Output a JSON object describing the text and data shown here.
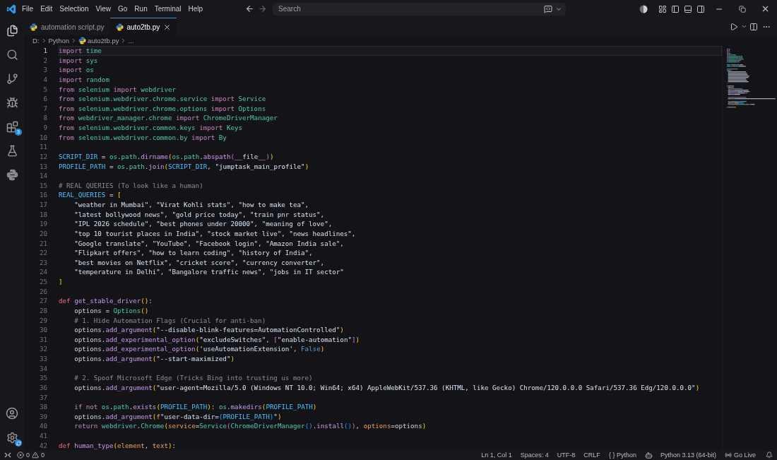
{
  "menu": [
    "File",
    "Edit",
    "Selection",
    "View",
    "Go",
    "Run",
    "Terminal",
    "Help"
  ],
  "search": {
    "placeholder": "Search"
  },
  "activity": {
    "extensions_badge": "3"
  },
  "tabs": [
    {
      "label": "automation script.py",
      "selected": false
    },
    {
      "label": "auto2tb.py",
      "selected": true
    }
  ],
  "breadcrumb": [
    {
      "kind": "folder",
      "label": "D:"
    },
    {
      "kind": "folder",
      "label": "Python"
    },
    {
      "kind": "file",
      "label": "auto2tb.py"
    },
    {
      "kind": "more",
      "label": "..."
    }
  ],
  "editor": {
    "lines": [
      {
        "number": "1",
        "current": true,
        "tokens": [
          {
            "kind": "kw",
            "text": "import "
          },
          {
            "kind": "mod",
            "text": "time"
          }
        ]
      },
      {
        "number": "2",
        "current": false,
        "tokens": [
          {
            "kind": "kw",
            "text": "import "
          },
          {
            "kind": "mod",
            "text": "sys"
          }
        ]
      },
      {
        "number": "3",
        "current": false,
        "tokens": [
          {
            "kind": "kw",
            "text": "import "
          },
          {
            "kind": "mod",
            "text": "os"
          }
        ]
      },
      {
        "number": "4",
        "current": false,
        "tokens": [
          {
            "kind": "kw",
            "text": "import "
          },
          {
            "kind": "mod",
            "text": "random"
          }
        ]
      },
      {
        "number": "5",
        "current": false,
        "tokens": [
          {
            "kind": "kw",
            "text": "from "
          },
          {
            "kind": "mod",
            "text": "selenium "
          },
          {
            "kind": "kw",
            "text": "import "
          },
          {
            "kind": "mod",
            "text": "webdriver"
          }
        ]
      },
      {
        "number": "6",
        "current": false,
        "tokens": [
          {
            "kind": "kw",
            "text": "from "
          },
          {
            "kind": "mod",
            "text": "selenium.webdriver.chrome.service "
          },
          {
            "kind": "kw",
            "text": "import "
          },
          {
            "kind": "cls",
            "text": "Service"
          }
        ]
      },
      {
        "number": "7",
        "current": false,
        "tokens": [
          {
            "kind": "kw",
            "text": "from "
          },
          {
            "kind": "mod",
            "text": "selenium.webdriver.chrome.options "
          },
          {
            "kind": "kw",
            "text": "import "
          },
          {
            "kind": "cls",
            "text": "Options"
          }
        ]
      },
      {
        "number": "8",
        "current": false,
        "tokens": [
          {
            "kind": "kw",
            "text": "from "
          },
          {
            "kind": "mod",
            "text": "webdriver_manager.chrome "
          },
          {
            "kind": "kw",
            "text": "import "
          },
          {
            "kind": "cls",
            "text": "ChromeDriverManager"
          }
        ]
      },
      {
        "number": "9",
        "current": false,
        "tokens": [
          {
            "kind": "kw",
            "text": "from "
          },
          {
            "kind": "mod",
            "text": "selenium.webdriver.common.keys "
          },
          {
            "kind": "kw",
            "text": "import "
          },
          {
            "kind": "cls",
            "text": "Keys"
          }
        ]
      },
      {
        "number": "10",
        "current": false,
        "tokens": [
          {
            "kind": "kw",
            "text": "from "
          },
          {
            "kind": "mod",
            "text": "selenium.webdriver.common.by "
          },
          {
            "kind": "kw",
            "text": "import "
          },
          {
            "kind": "cls",
            "text": "By"
          }
        ]
      },
      {
        "number": "11",
        "current": false
      },
      {
        "number": "12",
        "current": false,
        "tokens": [
          {
            "kind": "const",
            "text": "SCRIPT_DIR"
          },
          {
            "kind": "plain",
            "text": " = "
          },
          {
            "kind": "mod",
            "text": "os"
          },
          {
            "kind": "plain",
            "text": "."
          },
          {
            "kind": "mod",
            "text": "path"
          },
          {
            "kind": "plain",
            "text": "."
          },
          {
            "kind": "fn",
            "text": "dirname"
          },
          {
            "kind": "b1",
            "text": "("
          },
          {
            "kind": "mod",
            "text": "os"
          },
          {
            "kind": "plain",
            "text": "."
          },
          {
            "kind": "mod",
            "text": "path"
          },
          {
            "kind": "plain",
            "text": "."
          },
          {
            "kind": "fn",
            "text": "abspath"
          },
          {
            "kind": "b2",
            "text": "("
          },
          {
            "kind": "var",
            "text": "__file__"
          },
          {
            "kind": "b2",
            "text": ")"
          },
          {
            "kind": "b1",
            "text": ")"
          }
        ]
      },
      {
        "number": "13",
        "current": false,
        "tokens": [
          {
            "kind": "const",
            "text": "PROFILE_PATH"
          },
          {
            "kind": "plain",
            "text": " = "
          },
          {
            "kind": "mod",
            "text": "os"
          },
          {
            "kind": "plain",
            "text": "."
          },
          {
            "kind": "mod",
            "text": "path"
          },
          {
            "kind": "plain",
            "text": "."
          },
          {
            "kind": "fn",
            "text": "join"
          },
          {
            "kind": "b1",
            "text": "("
          },
          {
            "kind": "const",
            "text": "SCRIPT_DIR"
          },
          {
            "kind": "plain",
            "text": ", "
          },
          {
            "kind": "str",
            "text": "\"jumptask_main_profile\""
          },
          {
            "kind": "b1",
            "text": ")"
          }
        ]
      },
      {
        "number": "14",
        "current": false
      },
      {
        "number": "15",
        "current": false,
        "tokens": [
          {
            "kind": "com",
            "text": "# REAL QUERIES (To look like a human)"
          }
        ]
      },
      {
        "number": "16",
        "current": false,
        "tokens": [
          {
            "kind": "const",
            "text": "REAL_QUERIES"
          },
          {
            "kind": "plain",
            "text": " = "
          },
          {
            "kind": "b1",
            "text": "["
          }
        ]
      },
      {
        "number": "17",
        "current": false,
        "tokens": [
          {
            "kind": "str",
            "text": "    \"weather in Mumbai\", \"Virat Kohli stats\", \"how to make tea\","
          }
        ]
      },
      {
        "number": "18",
        "current": false,
        "tokens": [
          {
            "kind": "str",
            "text": "    \"latest bollywood news\", \"gold price today\", \"train pnr status\","
          }
        ]
      },
      {
        "number": "19",
        "current": false,
        "tokens": [
          {
            "kind": "str",
            "text": "    \"IPL 2026 schedule\", \"best phones under 20000\", \"meaning of love\","
          }
        ]
      },
      {
        "number": "20",
        "current": false,
        "tokens": [
          {
            "kind": "str",
            "text": "    \"top 10 tourist places in India\", \"stock market live\", \"news headlines\","
          }
        ]
      },
      {
        "number": "21",
        "current": false,
        "tokens": [
          {
            "kind": "str",
            "text": "    \"Google translate\", \"YouTube\", \"Facebook login\", \"Amazon India sale\","
          }
        ]
      },
      {
        "number": "22",
        "current": false,
        "tokens": [
          {
            "kind": "str",
            "text": "    \"Flipkart offers\", \"how to learn coding\", \"history of India\","
          }
        ]
      },
      {
        "number": "23",
        "current": false,
        "tokens": [
          {
            "kind": "str",
            "text": "    \"best movies on Netflix\", \"cricket score\", \"currency converter\","
          }
        ]
      },
      {
        "number": "24",
        "current": false,
        "tokens": [
          {
            "kind": "str",
            "text": "    \"temperature in Delhi\", \"Bangalore traffic news\", \"jobs in IT sector\""
          }
        ]
      },
      {
        "number": "25",
        "current": false,
        "tokens": [
          {
            "kind": "b1",
            "text": "]"
          }
        ]
      },
      {
        "number": "26",
        "current": false
      },
      {
        "number": "27",
        "current": false,
        "tokens": [
          {
            "kind": "def",
            "text": "def "
          },
          {
            "kind": "fn",
            "text": "get_stable_driver"
          },
          {
            "kind": "b1",
            "text": "()"
          },
          {
            "kind": "plain",
            "text": ":"
          }
        ]
      },
      {
        "number": "28",
        "current": false,
        "tokens": [
          {
            "kind": "plain",
            "text": "    options = "
          },
          {
            "kind": "cls",
            "text": "Options"
          },
          {
            "kind": "b1",
            "text": "()"
          }
        ]
      },
      {
        "number": "29",
        "current": false,
        "tokens": [
          {
            "kind": "com",
            "text": "    # 1. Hide Automation Flags (Crucial for anti-ban)"
          }
        ]
      },
      {
        "number": "30",
        "current": false,
        "tokens": [
          {
            "kind": "plain",
            "text": "    options."
          },
          {
            "kind": "fn",
            "text": "add_argument"
          },
          {
            "kind": "b1",
            "text": "("
          },
          {
            "kind": "str",
            "text": "\"--disable-blink-features=AutomationControlled\""
          },
          {
            "kind": "b1",
            "text": ")"
          }
        ]
      },
      {
        "number": "31",
        "current": false,
        "tokens": [
          {
            "kind": "plain",
            "text": "    options."
          },
          {
            "kind": "fn",
            "text": "add_experimental_option"
          },
          {
            "kind": "b1",
            "text": "("
          },
          {
            "kind": "str",
            "text": "\"excludeSwitches\""
          },
          {
            "kind": "plain",
            "text": ", "
          },
          {
            "kind": "b2",
            "text": "["
          },
          {
            "kind": "str",
            "text": "\"enable-automation\""
          },
          {
            "kind": "b2",
            "text": "]"
          },
          {
            "kind": "b1",
            "text": ")"
          }
        ]
      },
      {
        "number": "32",
        "current": false,
        "tokens": [
          {
            "kind": "plain",
            "text": "    options."
          },
          {
            "kind": "fn",
            "text": "add_experimental_option"
          },
          {
            "kind": "b1",
            "text": "("
          },
          {
            "kind": "str",
            "text": "'useAutomationExtension'"
          },
          {
            "kind": "plain",
            "text": ", "
          },
          {
            "kind": "bool",
            "text": "False"
          },
          {
            "kind": "b1",
            "text": ")"
          }
        ]
      },
      {
        "number": "33",
        "current": false,
        "tokens": [
          {
            "kind": "plain",
            "text": "    options."
          },
          {
            "kind": "fn",
            "text": "add_argument"
          },
          {
            "kind": "b1",
            "text": "("
          },
          {
            "kind": "str",
            "text": "\"--start-maximized\""
          },
          {
            "kind": "b1",
            "text": ")"
          }
        ]
      },
      {
        "number": "34",
        "current": false
      },
      {
        "number": "35",
        "current": false,
        "tokens": [
          {
            "kind": "com",
            "text": "    # 2. Spoof Microsoft Edge (Tricks Bing into trusting us more)"
          }
        ]
      },
      {
        "number": "36",
        "current": false,
        "tokens": [
          {
            "kind": "plain",
            "text": "    options."
          },
          {
            "kind": "fn",
            "text": "add_argument"
          },
          {
            "kind": "b1",
            "text": "("
          },
          {
            "kind": "str",
            "text": "\"user-agent=Mozilla/5.0 (Windows NT 10.0; Win64; x64) AppleWebKit/537.36 (KHTML, like Gecko) Chrome/120.0.0.0 Safari/537.36 Edg/120.0.0.0\""
          },
          {
            "kind": "b1",
            "text": ")"
          }
        ]
      },
      {
        "number": "37",
        "current": false
      },
      {
        "number": "38",
        "current": false,
        "tokens": [
          {
            "kind": "kw",
            "text": "    if not "
          },
          {
            "kind": "mod",
            "text": "os"
          },
          {
            "kind": "plain",
            "text": "."
          },
          {
            "kind": "mod",
            "text": "path"
          },
          {
            "kind": "plain",
            "text": "."
          },
          {
            "kind": "fn",
            "text": "exists"
          },
          {
            "kind": "b1",
            "text": "("
          },
          {
            "kind": "const",
            "text": "PROFILE_PATH"
          },
          {
            "kind": "b1",
            "text": ")"
          },
          {
            "kind": "plain",
            "text": ": "
          },
          {
            "kind": "mod",
            "text": "os"
          },
          {
            "kind": "plain",
            "text": "."
          },
          {
            "kind": "fn",
            "text": "makedirs"
          },
          {
            "kind": "b1",
            "text": "("
          },
          {
            "kind": "const",
            "text": "PROFILE_PATH"
          },
          {
            "kind": "b1",
            "text": ")"
          }
        ]
      },
      {
        "number": "39",
        "current": false,
        "tokens": [
          {
            "kind": "plain",
            "text": "    options."
          },
          {
            "kind": "fn",
            "text": "add_argument"
          },
          {
            "kind": "b1",
            "text": "("
          },
          {
            "kind": "param",
            "text": "f"
          },
          {
            "kind": "str",
            "text": "\"user-data-dir="
          },
          {
            "kind": "b3",
            "text": "{"
          },
          {
            "kind": "const",
            "text": "PROFILE_PATH"
          },
          {
            "kind": "b3",
            "text": "}"
          },
          {
            "kind": "str",
            "text": "\""
          },
          {
            "kind": "b1",
            "text": ")"
          }
        ]
      },
      {
        "number": "40",
        "current": false,
        "tokens": [
          {
            "kind": "kw",
            "text": "    return "
          },
          {
            "kind": "mod",
            "text": "webdriver"
          },
          {
            "kind": "plain",
            "text": "."
          },
          {
            "kind": "cls",
            "text": "Chrome"
          },
          {
            "kind": "b1",
            "text": "("
          },
          {
            "kind": "param",
            "text": "service"
          },
          {
            "kind": "plain",
            "text": "="
          },
          {
            "kind": "cls",
            "text": "Service"
          },
          {
            "kind": "b2",
            "text": "("
          },
          {
            "kind": "cls",
            "text": "ChromeDriverManager"
          },
          {
            "kind": "b3",
            "text": "()"
          },
          {
            "kind": "plain",
            "text": "."
          },
          {
            "kind": "fn",
            "text": "install"
          },
          {
            "kind": "b3",
            "text": "()"
          },
          {
            "kind": "b2",
            "text": ")"
          },
          {
            "kind": "plain",
            "text": ", "
          },
          {
            "kind": "param",
            "text": "options"
          },
          {
            "kind": "plain",
            "text": "=options"
          },
          {
            "kind": "b1",
            "text": ")"
          }
        ]
      },
      {
        "number": "41",
        "current": false
      },
      {
        "number": "42",
        "current": false,
        "tokens": [
          {
            "kind": "def",
            "text": "def "
          },
          {
            "kind": "fn",
            "text": "human_type"
          },
          {
            "kind": "b1",
            "text": "("
          },
          {
            "kind": "param",
            "text": "element"
          },
          {
            "kind": "plain",
            "text": ", "
          },
          {
            "kind": "param",
            "text": "text"
          },
          {
            "kind": "b1",
            "text": ")"
          },
          {
            "kind": "plain",
            "text": ":"
          }
        ]
      }
    ]
  },
  "status_bar": {
    "errors": "0",
    "warnings": "0",
    "items": [
      {
        "kind": "plain",
        "text": "Ln 1, Col 1"
      },
      {
        "kind": "plain",
        "text": "Spaces: 4"
      },
      {
        "kind": "plain",
        "text": "UTF-8"
      },
      {
        "kind": "plain",
        "text": "CRLF"
      },
      {
        "kind": "plain",
        "text": "{ } Python"
      },
      {
        "kind": "copilot",
        "text": "Python 3.13 (64-bit)"
      },
      {
        "kind": "live",
        "text": "Go Live"
      }
    ]
  }
}
